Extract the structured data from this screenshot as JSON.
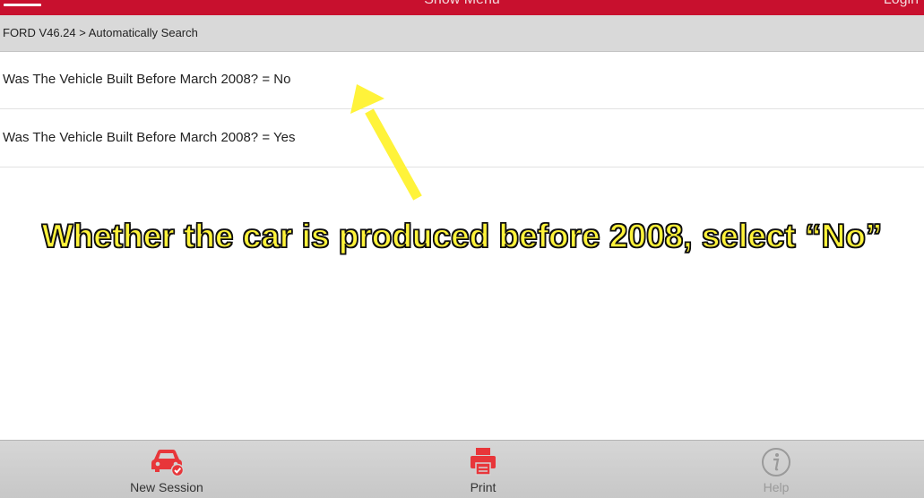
{
  "topbar": {
    "title": "Show Menu",
    "login": "Login"
  },
  "breadcrumb": {
    "text": "FORD V46.24 > Automatically Search"
  },
  "list": {
    "items": [
      {
        "label": "Was The Vehicle Built Before March 2008? = No"
      },
      {
        "label": "Was The Vehicle Built Before March 2008? = Yes"
      }
    ]
  },
  "annotation": {
    "caption": "Whether the car is produced before 2008, select “No”",
    "arrow_color": "#fff33a"
  },
  "bottombar": {
    "new_session": "New Session",
    "print": "Print",
    "help": "Help"
  },
  "colors": {
    "brand_red": "#c8102e",
    "caption_yellow": "#fff33a"
  },
  "icons": {
    "menu": "hamburger-icon",
    "new_session": "car-check-icon",
    "print": "printer-icon",
    "help": "info-icon"
  }
}
